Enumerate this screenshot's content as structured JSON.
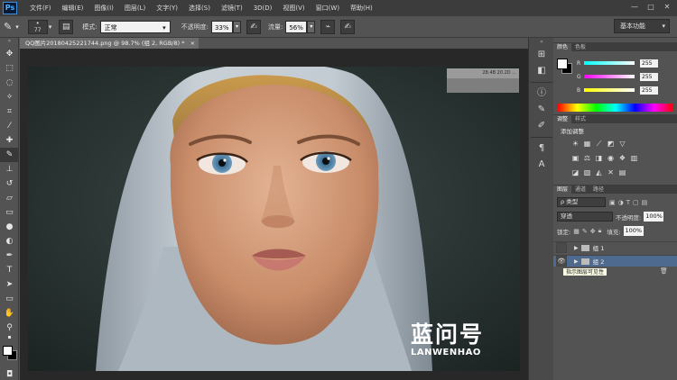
{
  "app": {
    "logo": "Ps"
  },
  "menu": [
    "文件(F)",
    "编辑(E)",
    "图像(I)",
    "图层(L)",
    "文字(Y)",
    "选择(S)",
    "滤镜(T)",
    "3D(D)",
    "视图(V)",
    "窗口(W)",
    "帮助(H)"
  ],
  "window_controls": {
    "minimize": "—",
    "maximize": "□",
    "close": "✕"
  },
  "options": {
    "brush_size": "77",
    "mode_label": "模式:",
    "mode_value": "正常",
    "opacity_label": "不透明度:",
    "opacity_value": "33%",
    "flow_label": "流量:",
    "flow_value": "56%",
    "workspace": "基本功能"
  },
  "document": {
    "tab_title": "QQ图片20180425221744.png @ 98.7% (组 2, RGB/8) *",
    "tab_close": "×",
    "ruler_text": "28.4B 20.2D ..."
  },
  "watermark": {
    "cn": "蓝问号",
    "en": "LANWENHAO"
  },
  "color_panel": {
    "tabs": [
      "颜色",
      "色板"
    ],
    "r_label": "R",
    "r_value": "255",
    "g_label": "G",
    "g_value": "255",
    "b_label": "B",
    "b_value": "255",
    "fg": "#ffffff",
    "bg": "#000000"
  },
  "adjustments_panel": {
    "tabs": [
      "调整",
      "样式"
    ],
    "title": "添加调整"
  },
  "layers_panel": {
    "tabs": [
      "图层",
      "通道",
      "路径"
    ],
    "filter_label": "ρ 类型",
    "blend_mode": "穿透",
    "opacity_label": "不透明度:",
    "opacity_value": "100%",
    "lock_label": "锁定:",
    "fill_label": "填充:",
    "fill_value": "100%",
    "layers": [
      {
        "name": "组 1",
        "visible": false,
        "selected": false
      },
      {
        "name": "组 2",
        "visible": true,
        "selected": true
      }
    ],
    "tooltip": "指示图层可见性"
  }
}
